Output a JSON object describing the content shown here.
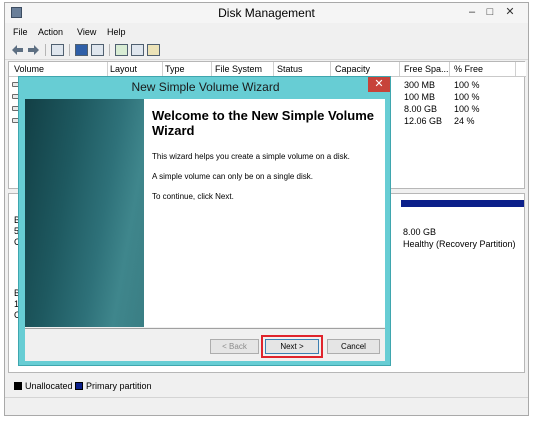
{
  "window": {
    "title": "Disk Management",
    "min": "–",
    "max": "□",
    "close": "✕"
  },
  "menu": {
    "file": "File",
    "action": "Action",
    "view": "View",
    "help": "Help"
  },
  "volume_list": {
    "columns": [
      "Volume",
      "Layout",
      "Type",
      "File System",
      "Status",
      "Capacity",
      "Free Spa...",
      "% Free"
    ],
    "free_space": [
      "300 MB",
      "100 MB",
      "8.00 GB",
      "12.06 GB"
    ],
    "percent_free": [
      "100 %",
      "100 %",
      "100 %",
      "24 %"
    ]
  },
  "disk_map": {
    "left_letters": [
      "B",
      "5",
      "C",
      "B",
      "1",
      "C"
    ],
    "partition_size": "8.00 GB",
    "partition_status": "Healthy (Recovery Partition)",
    "partition_color": "#0b1f8a"
  },
  "legend": {
    "unallocated": "Unallocated",
    "unallocated_color": "#000000",
    "primary": "Primary partition",
    "primary_color": "#0b1f8a"
  },
  "wizard": {
    "title": "New Simple Volume Wizard",
    "close": "✕",
    "heading": "Welcome to the New Simple Volume Wizard",
    "p1": "This wizard helps you create a simple volume on a disk.",
    "p2": "A simple volume can only be on a single disk.",
    "p3": "To continue, click Next.",
    "back": "< Back",
    "next": "Next >",
    "cancel": "Cancel",
    "highlight_color": "#e0242c"
  }
}
